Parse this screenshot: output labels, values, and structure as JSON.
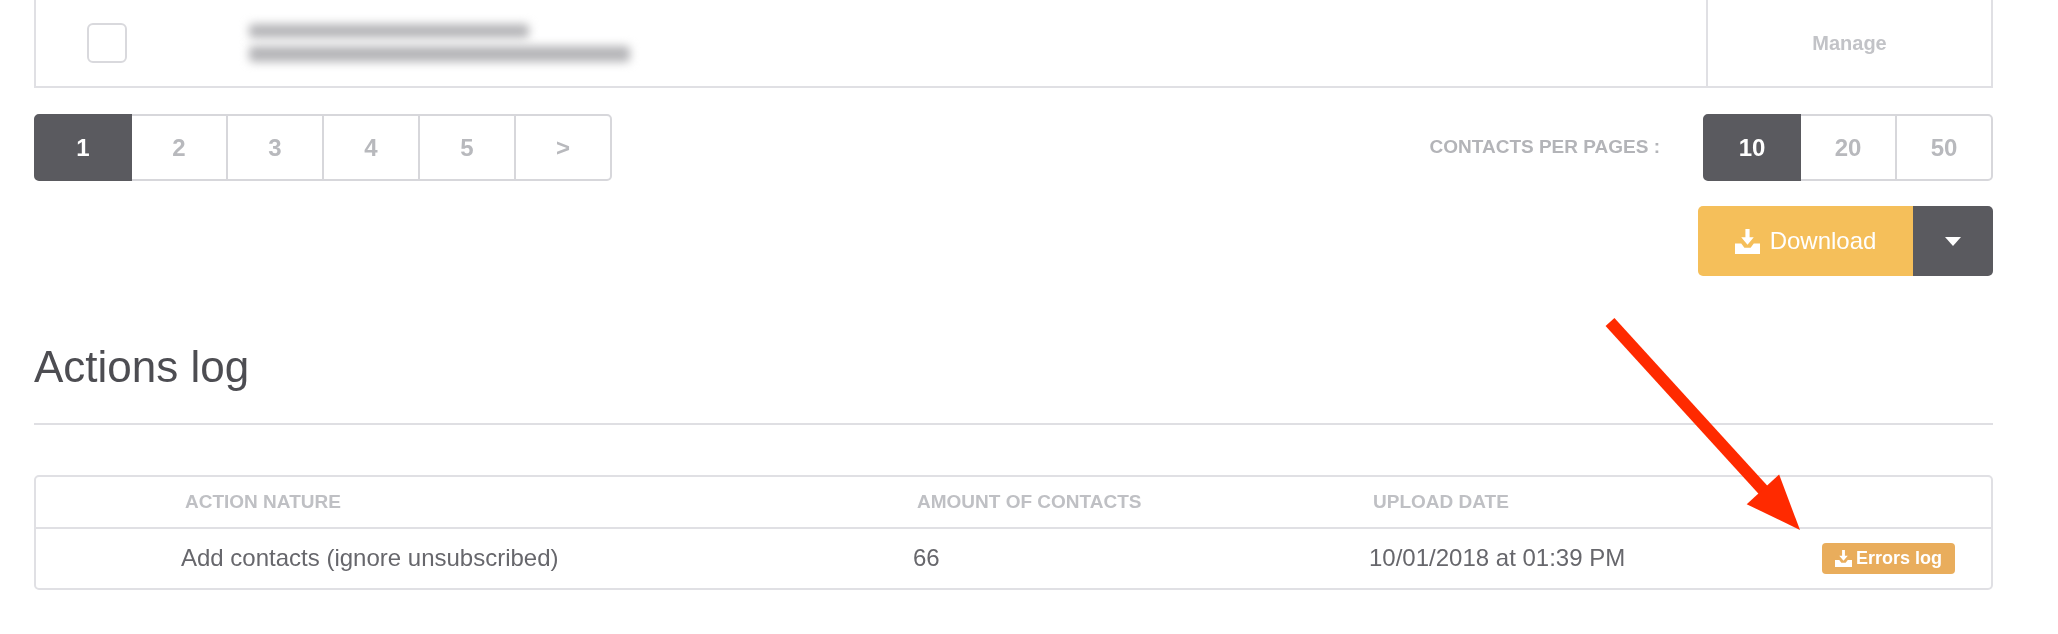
{
  "contacts_table": {
    "rows": [
      {
        "checked": false,
        "action": "Manage"
      }
    ]
  },
  "pagination": {
    "pages": [
      {
        "label": "1",
        "selected": true
      },
      {
        "label": "2",
        "selected": false
      },
      {
        "label": "3",
        "selected": false
      },
      {
        "label": "4",
        "selected": false
      },
      {
        "label": "5",
        "selected": false
      },
      {
        "label": ">",
        "selected": false
      }
    ]
  },
  "per_page": {
    "label": "CONTACTS PER PAGES :",
    "options": [
      {
        "label": "10",
        "selected": true
      },
      {
        "label": "20",
        "selected": false
      },
      {
        "label": "50",
        "selected": false
      }
    ]
  },
  "download_button": {
    "label": "Download"
  },
  "actions_log": {
    "title": "Actions log",
    "columns": [
      "ACTION NATURE",
      "AMOUNT OF CONTACTS",
      "UPLOAD DATE"
    ],
    "rows": [
      {
        "action_nature": "Add contacts (ignore unsubscribed)",
        "amount_of_contacts": "66",
        "upload_date": "10/01/2018 at 01:39 PM",
        "button": "Errors log"
      }
    ]
  }
}
